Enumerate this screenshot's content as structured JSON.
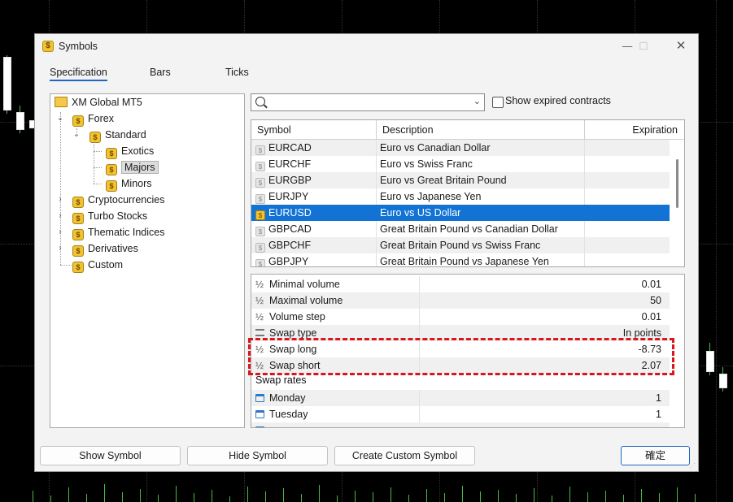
{
  "window": {
    "title": "Symbols",
    "min": "—",
    "max": "☐",
    "close": "✕"
  },
  "tabs": [
    {
      "label": "Specification",
      "active": true
    },
    {
      "label": "Bars"
    },
    {
      "label": "Ticks"
    }
  ],
  "tree": {
    "root": "XM Global MT5",
    "forex": "Forex",
    "standard": "Standard",
    "exotics": "Exotics",
    "majors": "Majors",
    "minors": "Minors",
    "crypto": "Cryptocurrencies",
    "turbo": "Turbo Stocks",
    "thematic": "Thematic Indices",
    "derivatives": "Derivatives",
    "custom": "Custom"
  },
  "search": {
    "value": "",
    "caret": "⌄"
  },
  "show_expired": {
    "label": "Show expired contracts",
    "checked": false
  },
  "table": {
    "headers": {
      "symbol": "Symbol",
      "description": "Description",
      "expiration": "Expiration"
    },
    "rows": [
      {
        "symbol": "EURCAD",
        "description": "Euro vs Canadian Dollar"
      },
      {
        "symbol": "EURCHF",
        "description": "Euro vs Swiss Franc"
      },
      {
        "symbol": "EURGBP",
        "description": "Euro vs Great Britain Pound"
      },
      {
        "symbol": "EURJPY",
        "description": "Euro vs Japanese Yen"
      },
      {
        "symbol": "EURUSD",
        "description": "Euro vs US Dollar",
        "selected": true
      },
      {
        "symbol": "GBPCAD",
        "description": "Great Britain Pound vs Canadian Dollar"
      },
      {
        "symbol": "GBPCHF",
        "description": "Great Britain Pound vs Swiss Franc"
      },
      {
        "symbol": "GBPJPY",
        "description": "Great Britain Pound vs Japanese Yen"
      }
    ]
  },
  "props": {
    "min_volume": {
      "name": "Minimal volume",
      "value": "0.01"
    },
    "max_volume": {
      "name": "Maximal volume",
      "value": "50"
    },
    "volume_step": {
      "name": "Volume step",
      "value": "0.01"
    },
    "swap_type": {
      "name": "Swap type",
      "value": "In points"
    },
    "swap_long": {
      "name": "Swap long",
      "value": "-8.73"
    },
    "swap_short": {
      "name": "Swap short",
      "value": "2.07"
    },
    "swap_rates": "Swap rates",
    "monday": {
      "name": "Monday",
      "value": "1"
    },
    "tuesday": {
      "name": "Tuesday",
      "value": "1"
    },
    "half_glyph": "½"
  },
  "buttons": {
    "show_symbol": "Show Symbol",
    "hide_symbol": "Hide Symbol",
    "create_custom": "Create Custom Symbol",
    "ok": "確定"
  },
  "colors": {
    "accent": "#1373d4",
    "highlight": "#d6171c",
    "chart_bg": "#000000",
    "bull": "#3fbf3f"
  }
}
